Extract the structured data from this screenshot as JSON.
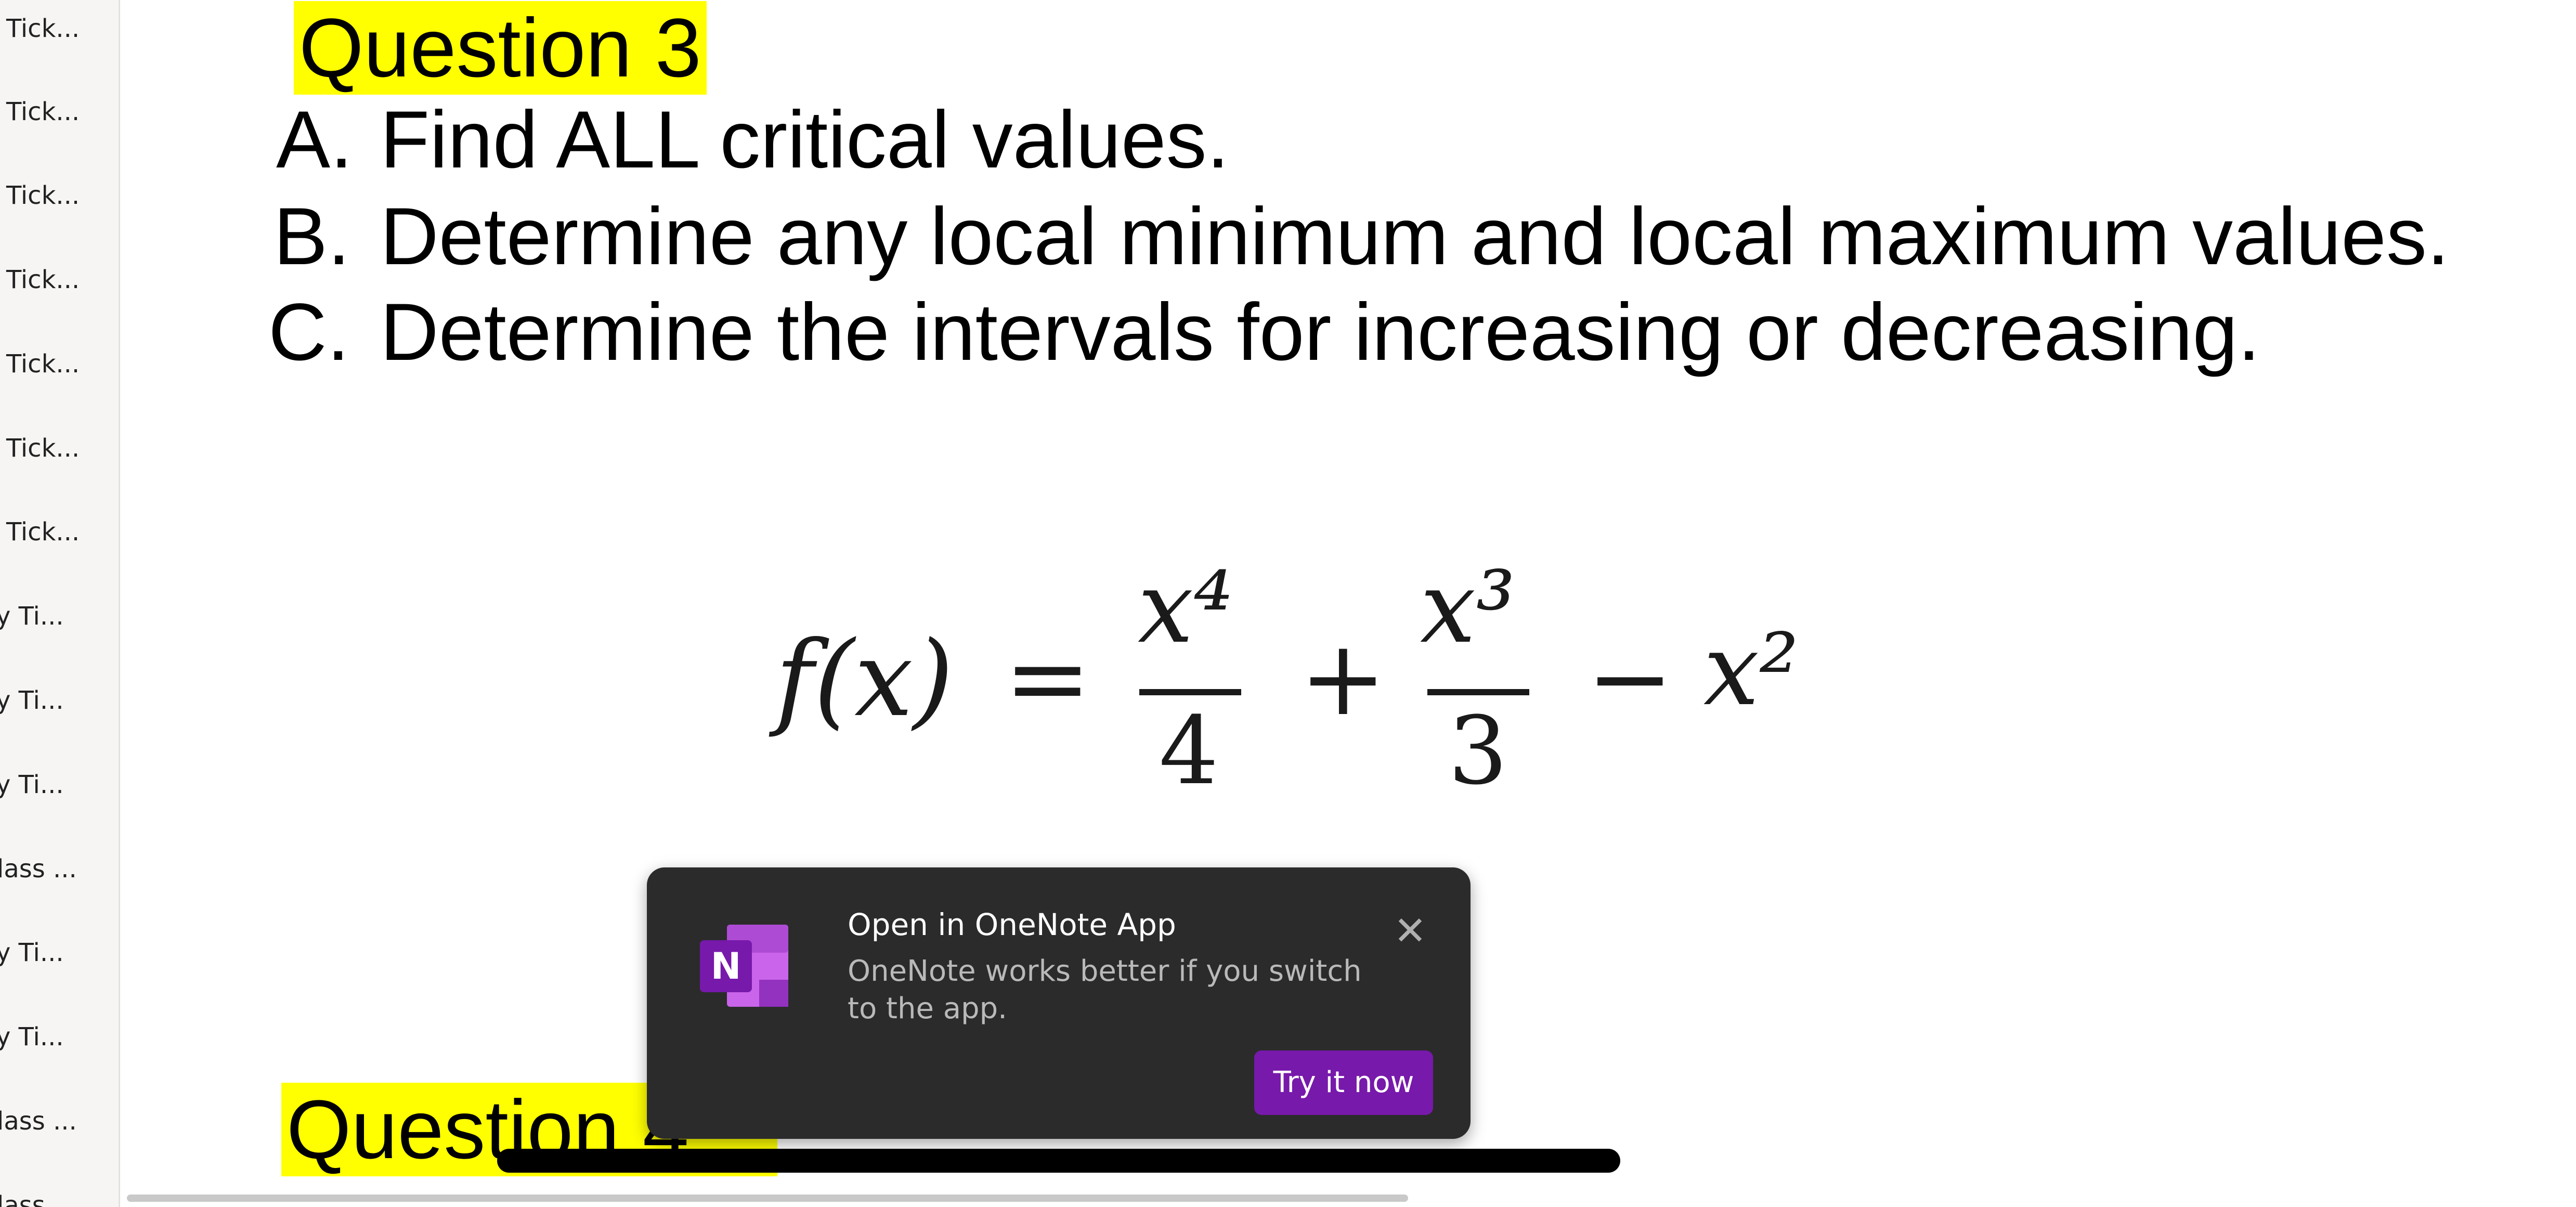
{
  "sidebar": {
    "items": [
      {
        "label": "Tick..."
      },
      {
        "label": "Tick..."
      },
      {
        "label": "Tick..."
      },
      {
        "label": "Tick..."
      },
      {
        "label": "Tick..."
      },
      {
        "label": "Tick..."
      },
      {
        "label": "Tick..."
      },
      {
        "label": "y Ti..."
      },
      {
        "label": "y Ti..."
      },
      {
        "label": "y Ti..."
      },
      {
        "label": "lass ..."
      },
      {
        "label": "y Ti..."
      },
      {
        "label": "y Ti..."
      },
      {
        "label": "lass ..."
      },
      {
        "label": "lass..."
      }
    ]
  },
  "content": {
    "question3_heading": "Question 3",
    "items": [
      {
        "marker": "A.",
        "text": "Find ALL critical values."
      },
      {
        "marker": "B.",
        "text": "Determine any local minimum and local maximum values."
      },
      {
        "marker": "C.",
        "text": "Determine the intervals for increasing or decreasing."
      }
    ],
    "equation": {
      "lhs": "f(x)",
      "equals": "=",
      "term1_num": "x⁴",
      "term1_den": "4",
      "plus": "+",
      "term2_num": "x³",
      "term2_den": "3",
      "minus": "−",
      "term3": "x²"
    },
    "question4_heading": "Question 4"
  },
  "toast": {
    "icon": "onenote-logo-icon",
    "icon_letter": "N",
    "title": "Open in OneNote App",
    "body": "OneNote works better if you switch to the app.",
    "close_symbol": "✕",
    "button_label": "Try it now",
    "accent_color": "#7719aa"
  },
  "colors": {
    "highlight": "#ffff00",
    "toast_background": "#2b2b2b",
    "sidebar_background": "#f6f5f4"
  }
}
